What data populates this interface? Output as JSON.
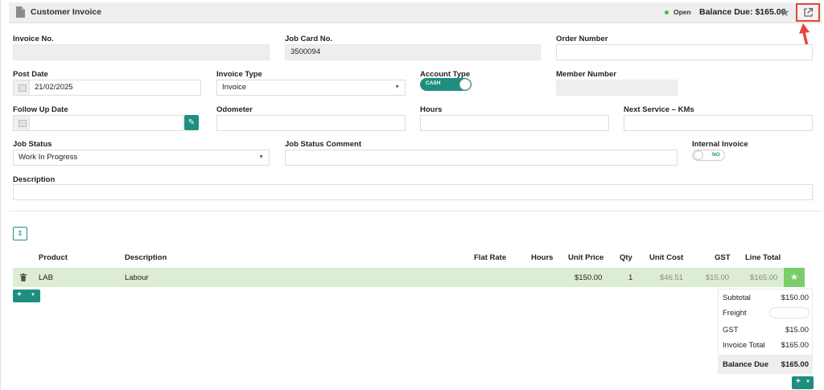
{
  "header": {
    "title": "Customer Invoice",
    "status": "Open",
    "balance": "Balance Due: $165.00"
  },
  "form": {
    "invoice_no": {
      "label": "Invoice No.",
      "value": ""
    },
    "job_card_no": {
      "label": "Job Card No.",
      "value": "3500094"
    },
    "order_number": {
      "label": "Order Number",
      "value": ""
    },
    "post_date": {
      "label": "Post Date",
      "value": "21/02/2025"
    },
    "invoice_type": {
      "label": "Invoice Type",
      "value": "Invoice"
    },
    "account_type": {
      "label": "Account Type",
      "toggle_text": "CASH"
    },
    "member_number": {
      "label": "Member Number",
      "value": ""
    },
    "follow_up_date": {
      "label": "Follow Up Date",
      "value": ""
    },
    "odometer": {
      "label": "Odometer",
      "value": ""
    },
    "hours": {
      "label": "Hours",
      "value": ""
    },
    "next_service": {
      "label": "Next Service – KMs",
      "value": ""
    },
    "job_status": {
      "label": "Job Status",
      "value": "Work In Progress"
    },
    "job_status_comment": {
      "label": "Job Status Comment",
      "value": ""
    },
    "internal_invoice": {
      "label": "Internal Invoice",
      "toggle_text": "NO"
    },
    "description": {
      "label": "Description",
      "value": ""
    }
  },
  "table": {
    "columns": [
      "Product",
      "Description",
      "Flat Rate",
      "Hours",
      "Unit Price",
      "Qty",
      "Unit Cost",
      "GST",
      "Line Total"
    ],
    "rows": [
      {
        "product": "LAB",
        "description": "Labour",
        "flat_rate": "",
        "hours": "",
        "unit_price": "$150.00",
        "qty": "1",
        "unit_cost": "$46.51",
        "gst": "$15.00",
        "line_total": "$165.00"
      }
    ]
  },
  "totals": {
    "subtotal_label": "Subtotal",
    "subtotal": "$150.00",
    "freight_label": "Freight",
    "freight": "",
    "gst_label": "GST",
    "gst": "$15.00",
    "invoice_total_label": "Invoice Total",
    "invoice_total": "$165.00",
    "balance_due_label": "Balance Due",
    "balance_due": "$165.00"
  },
  "icons": {
    "add": "+",
    "star": "★",
    "sort": "⇕",
    "edit": "✎"
  },
  "colors": {
    "accent": "#1e8f7e",
    "row_highlight": "#dcedd3",
    "star_green": "#7ccd6a",
    "annotation_red": "#e5453a"
  }
}
